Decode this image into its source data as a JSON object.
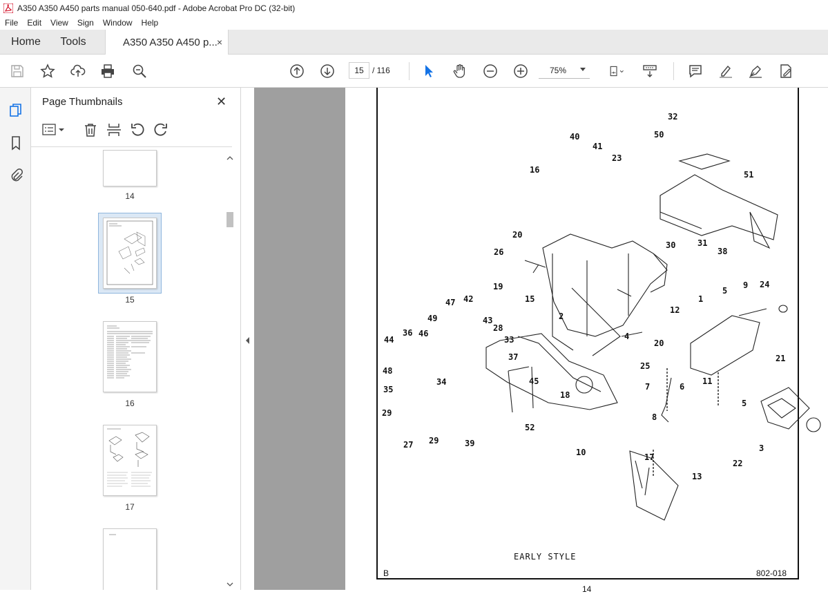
{
  "window": {
    "title": "A350 A350 A450 parts manual 050-640.pdf - Adobe Acrobat Pro DC (32-bit)"
  },
  "menu": [
    "File",
    "Edit",
    "View",
    "Sign",
    "Window",
    "Help"
  ],
  "tabs": {
    "home": "Home",
    "tools": "Tools",
    "doc": "A350 A350 A450 p...",
    "close": "×"
  },
  "toolbar": {
    "page_current": "15",
    "page_total": "/ 116",
    "zoom": "75%"
  },
  "panel": {
    "title": "Page Thumbnails",
    "close": "✕"
  },
  "thumbnails": [
    {
      "page": "14"
    },
    {
      "page": "15",
      "selected": true
    },
    {
      "page": "16"
    },
    {
      "page": "17"
    }
  ],
  "drawing": {
    "callouts": [
      "32",
      "50",
      "40",
      "41",
      "23",
      "16",
      "51",
      "20",
      "26",
      "30",
      "31",
      "38",
      "19",
      "15",
      "2",
      "12",
      "47",
      "42",
      "43",
      "28",
      "49",
      "33",
      "37",
      "36",
      "46",
      "44",
      "48",
      "34",
      "35",
      "29",
      "27",
      "29",
      "39",
      "52",
      "45",
      "18",
      "1",
      "5",
      "9",
      "24",
      "4",
      "20",
      "25",
      "21",
      "7",
      "6",
      "11",
      "5",
      "8",
      "17",
      "13",
      "22",
      "3",
      "10"
    ],
    "caption": "EARLY STYLE",
    "corner_left": "B",
    "corner_right": "802-018",
    "page_number": "14"
  }
}
